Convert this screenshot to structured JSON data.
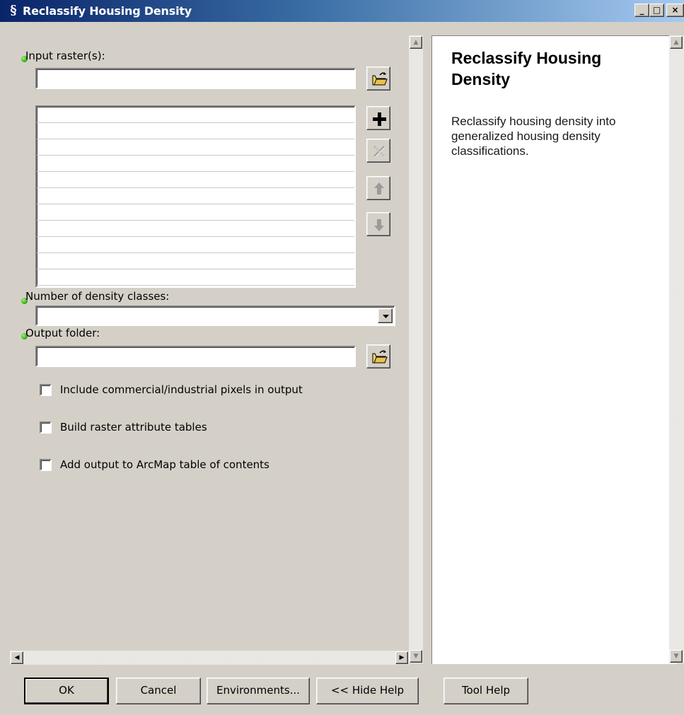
{
  "window": {
    "title": "Reclassify Housing Density",
    "minimize_glyph": "_",
    "maximize_glyph": "□",
    "close_glyph": "×"
  },
  "form": {
    "input_rasters_label": "Input raster(s):",
    "input_rasters_value": "",
    "input_rasters_list": [
      "",
      "",
      "",
      "",
      "",
      "",
      "",
      "",
      "",
      "",
      ""
    ],
    "density_classes_label": "Number of density classes:",
    "density_classes_value": "",
    "output_folder_label": "Output folder:",
    "output_folder_value": "",
    "checkboxes": [
      {
        "label": "Include commercial/industrial pixels in output",
        "checked": false
      },
      {
        "label": "Build raster attribute tables",
        "checked": false
      },
      {
        "label": "Add output to ArcMap table of contents",
        "checked": false
      }
    ]
  },
  "help": {
    "title": "Reclassify Housing Density",
    "body": "Reclassify housing density into generalized housing density classifications."
  },
  "buttons": {
    "ok": "OK",
    "cancel": "Cancel",
    "environments": "Environments...",
    "hide_help": "<< Hide Help",
    "tool_help": "Tool Help"
  },
  "icons": {
    "title": "arcgis-tool-icon",
    "browse": "open-folder-icon",
    "add": "plus-icon",
    "remove": "x-icon",
    "up": "arrow-up-icon",
    "down": "arrow-down-icon"
  },
  "colors": {
    "required_dot": "#2aa612",
    "titlebar_start": "#0a246a",
    "titlebar_end": "#a6caf0"
  }
}
